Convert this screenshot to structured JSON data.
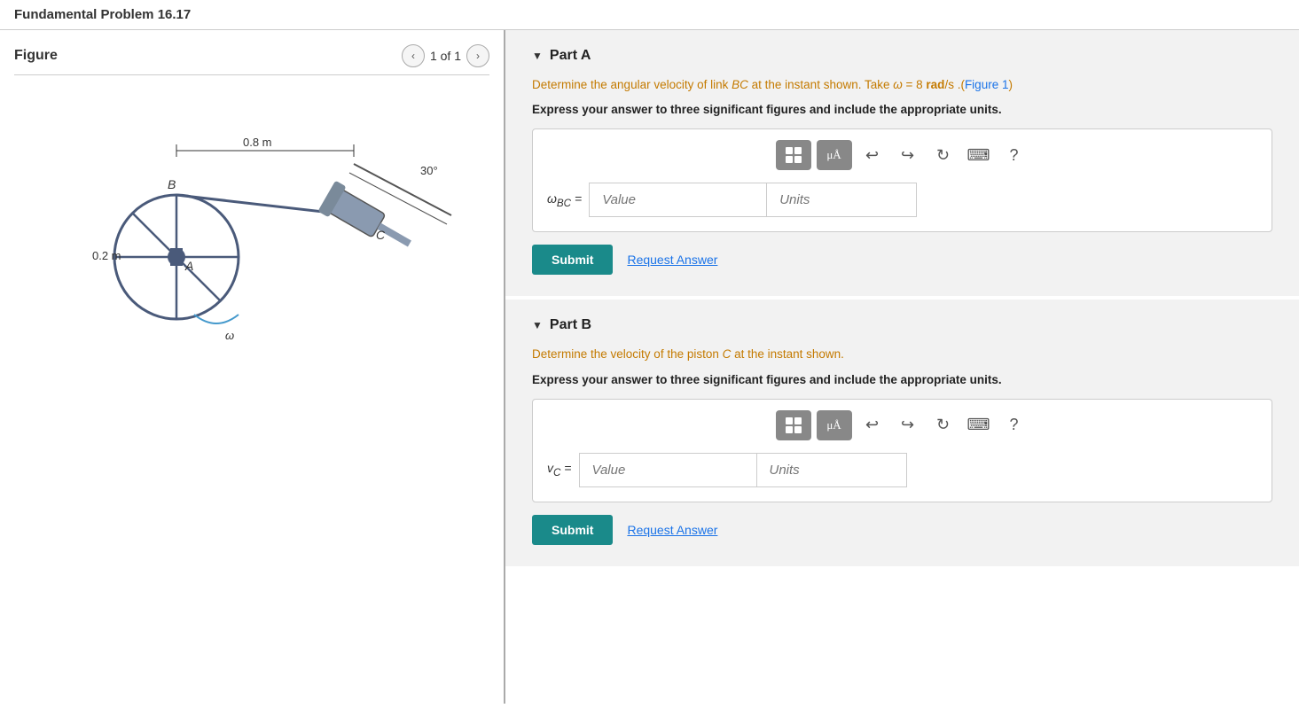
{
  "header": {
    "title": "Fundamental Problem 16.17"
  },
  "figure": {
    "title": "Figure",
    "nav": {
      "current": "1 of 1",
      "prev_label": "‹",
      "next_label": "›"
    }
  },
  "parts": [
    {
      "id": "part-a",
      "title": "Part A",
      "description": "Determine the angular velocity of link BC at the instant shown. Take ω = 8 rad/s .(Figure 1)",
      "instruction": "Express your answer to three significant figures and include the appropriate units.",
      "label": "ωBC =",
      "value_placeholder": "Value",
      "units_placeholder": "Units",
      "submit_label": "Submit",
      "request_answer_label": "Request Answer"
    },
    {
      "id": "part-b",
      "title": "Part B",
      "description": "Determine the velocity of the piston C at the instant shown.",
      "instruction": "Express your answer to three significant figures and include the appropriate units.",
      "label": "vC =",
      "value_placeholder": "Value",
      "units_placeholder": "Units",
      "submit_label": "Submit",
      "request_answer_label": "Request Answer"
    }
  ],
  "toolbar": {
    "grid_label": "⊞",
    "mu_label": "μÅ",
    "undo_label": "↩",
    "redo_label": "↪",
    "refresh_label": "↻",
    "keyboard_label": "⌨",
    "help_label": "?"
  }
}
